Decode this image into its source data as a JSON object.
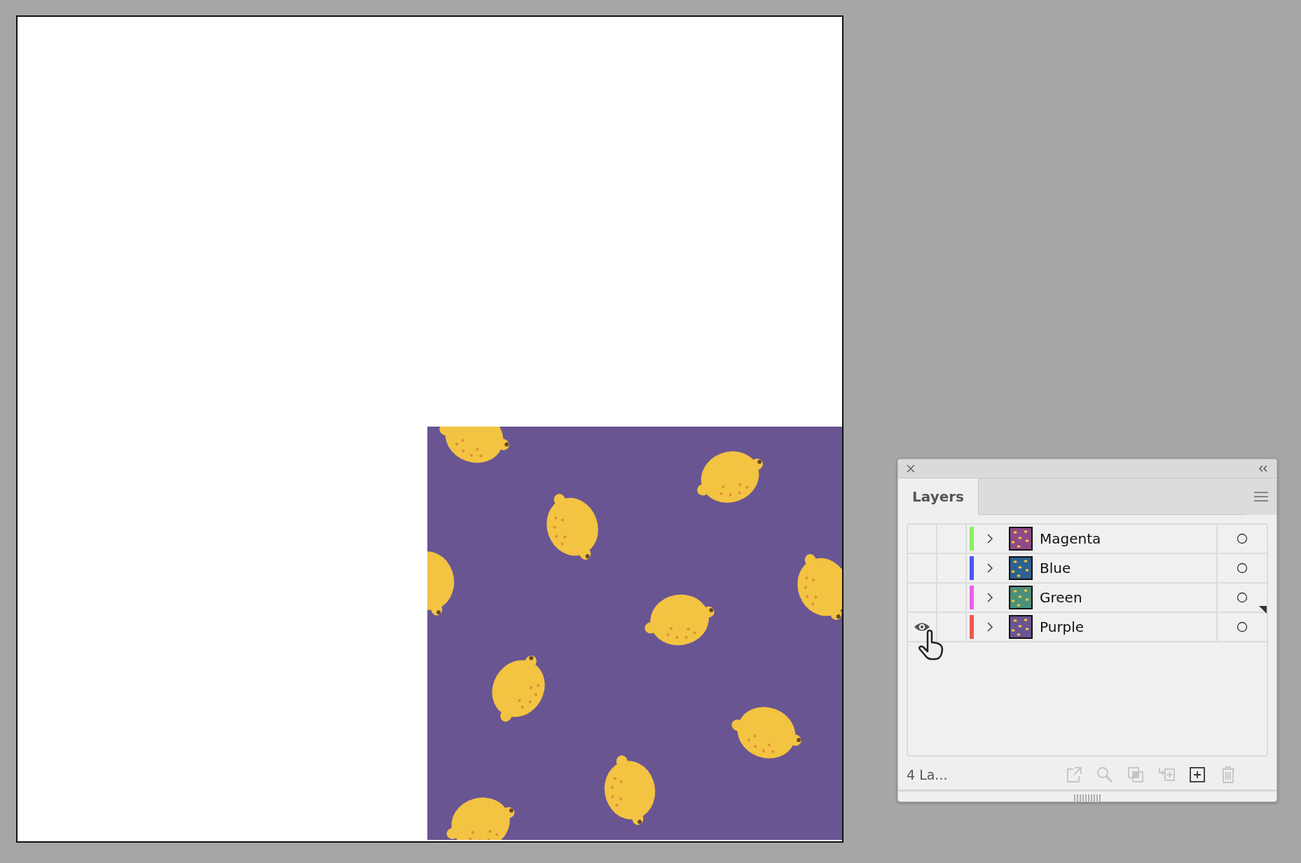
{
  "tabs": [
    {
      "label": "Layers",
      "selected": true
    }
  ],
  "layers": [
    {
      "name": "Magenta",
      "visible": false,
      "color": "#88f060",
      "thumbnail": {
        "color": "#8e4a86"
      },
      "expanded": false,
      "current": false
    },
    {
      "name": "Blue",
      "visible": false,
      "color": "#4a55f5",
      "thumbnail": {
        "color": "#2d6190"
      },
      "expanded": false,
      "current": false
    },
    {
      "name": "Green",
      "visible": false,
      "color": "#f05cf0",
      "thumbnail": {
        "color": "#4a907a"
      },
      "expanded": false,
      "current": true
    },
    {
      "name": "Purple",
      "visible": true,
      "color": "#f0584e",
      "thumbnail": {
        "color": "#6a5593"
      },
      "expanded": false,
      "current": false
    }
  ],
  "status": "4 La...",
  "footer_buttons": [
    {
      "kind": "export",
      "disabled": true
    },
    {
      "kind": "locate",
      "disabled": true
    },
    {
      "kind": "clipping-mask",
      "disabled": true
    },
    {
      "kind": "new-sublayer",
      "disabled": true
    },
    {
      "kind": "new-layer",
      "disabled": false
    },
    {
      "kind": "delete",
      "disabled": true
    }
  ]
}
